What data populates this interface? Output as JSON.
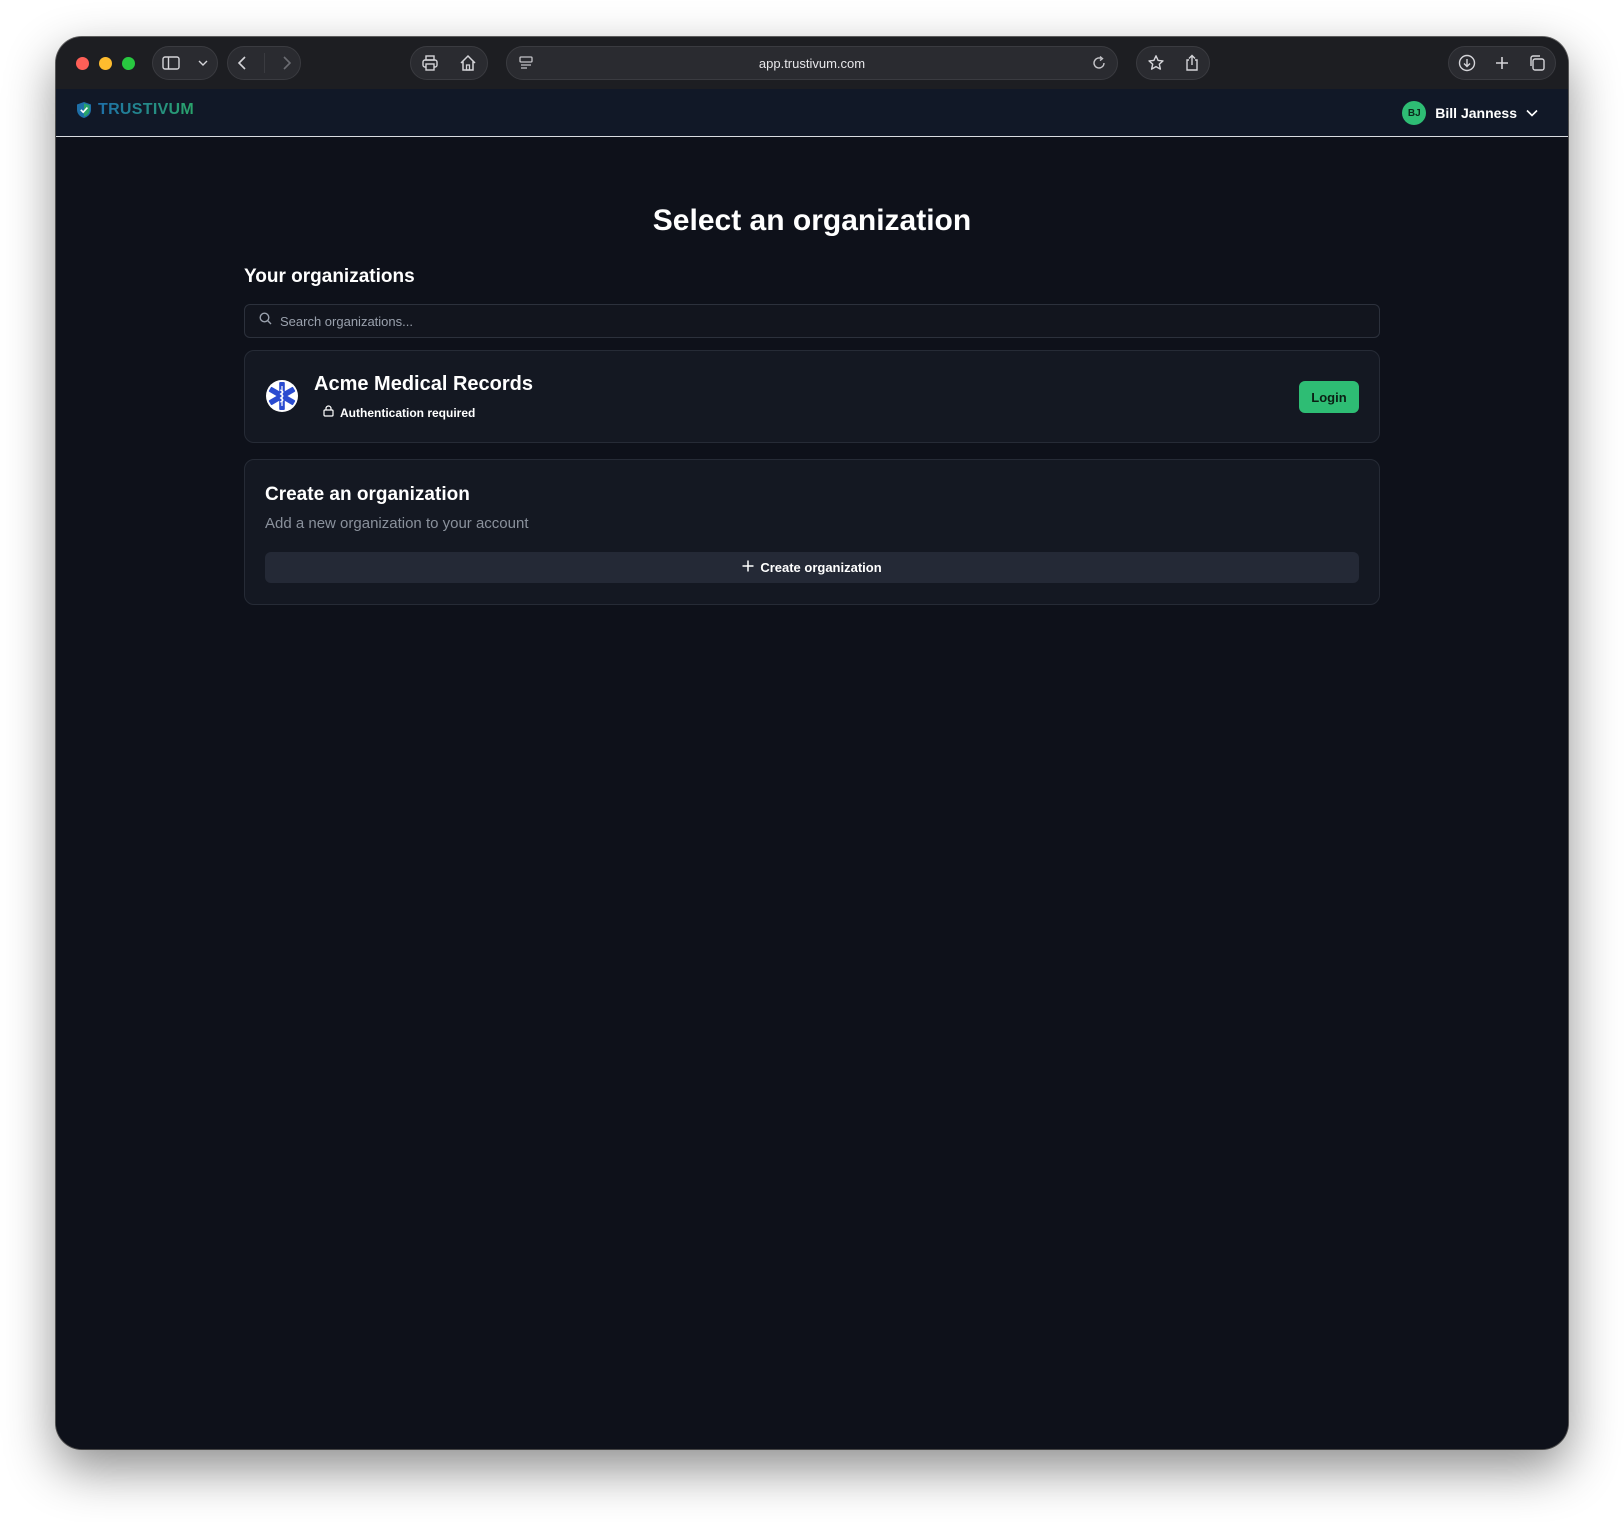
{
  "browser": {
    "url": "app.trustivum.com"
  },
  "header": {
    "brand": "TRUSTIVUM",
    "user": {
      "initials": "BJ",
      "name": "Bill Janness"
    }
  },
  "main": {
    "title": "Select an organization",
    "your_orgs_title": "Your organizations",
    "search_placeholder": "Search organizations...",
    "organizations": [
      {
        "name": "Acme Medical Records",
        "status": "Authentication required",
        "action_label": "Login"
      }
    ],
    "create": {
      "title": "Create an organization",
      "subtitle": "Add a new organization to your account",
      "button_label": "Create organization"
    }
  },
  "colors": {
    "accent": "#2ebd74",
    "background": "#0e111a",
    "card": "#141822"
  }
}
